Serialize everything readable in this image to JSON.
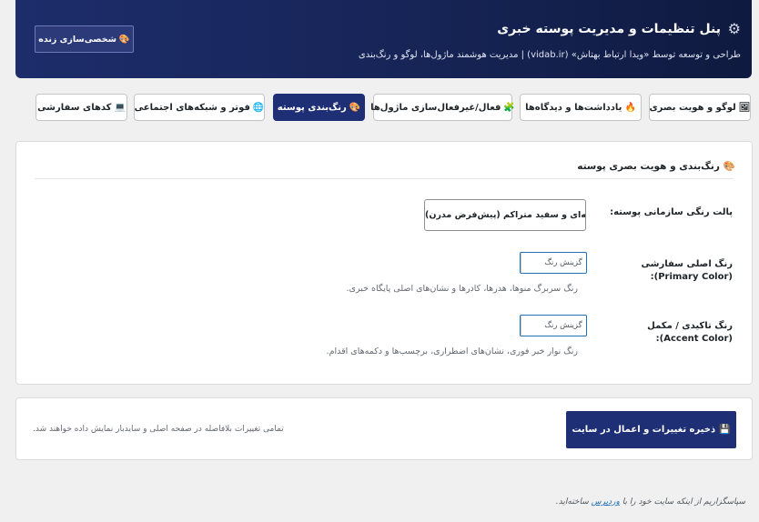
{
  "header": {
    "title": "پنل تنظیمات و مدیریت پوسته خبری",
    "subtitle": "طراحی و توسعه توسط «ویدا ارتباط بهتاش» (vidab.ir) | مدیریت هوشمند ماژول‌ها، لوگو و رنگ‌بندی",
    "live_button_icon": "🎨",
    "live_button": "شخصی‌سازی زنده"
  },
  "tabs": [
    {
      "icon": "🖼",
      "label": "لوگو و هویت بصری",
      "active": false
    },
    {
      "icon": "🔥",
      "label": "یادداشت‌ها و دیدگاه‌ها",
      "active": false
    },
    {
      "icon": "🧩",
      "label": "فعال/غیرفعال‌سازی ماژول‌ها",
      "active": false
    },
    {
      "icon": "🎨",
      "label": "رنگ‌بندی پوسته",
      "active": true
    },
    {
      "icon": "🌐",
      "label": "فوتر و شبکه‌های اجتماعی",
      "active": false
    },
    {
      "icon": "💻",
      "label": "کدهای سفارشی",
      "active": false
    }
  ],
  "card": {
    "icon": "🎨",
    "title": "رنگ‌بندی و هویت بصری پوسته",
    "palette_label": "پالت رنگی سازمانی پوسته:",
    "palette_value": "سرمه‌ای و سفید متراکم (پیش‌فرض مدرن)",
    "primary_label": "رنگ اصلی سفارشی (Primary Color):",
    "primary_button": "گزینش رنگ",
    "primary_desc": "رنگ سربرگ منوها، هدرها، کادرها و نشان‌های اصلی پایگاه خبری.",
    "accent_label": "رنگ تاکیدی / مکمل (Accent Color):",
    "accent_button": "گزینش رنگ",
    "accent_desc": "رنگ نوار خبر فوری، نشان‌های اضطراری، برچسب‌ها و دکمه‌های اقدام."
  },
  "save": {
    "icon": "💾",
    "button": "ذخیره تغییرات و اعمال در سایت",
    "note": "تمامی تغییرات بلافاصله در صفحه اصلی و سایدبار نمایش داده خواهند شد."
  },
  "footer": {
    "prefix": "سپاسگزاریم از اینکه سایت خود را با",
    "link": "وردپرس",
    "suffix": "ساخته‌اید."
  },
  "colors": {
    "header_bg": "#162456",
    "accent": "#1f2f75",
    "link": "#2271b1"
  }
}
